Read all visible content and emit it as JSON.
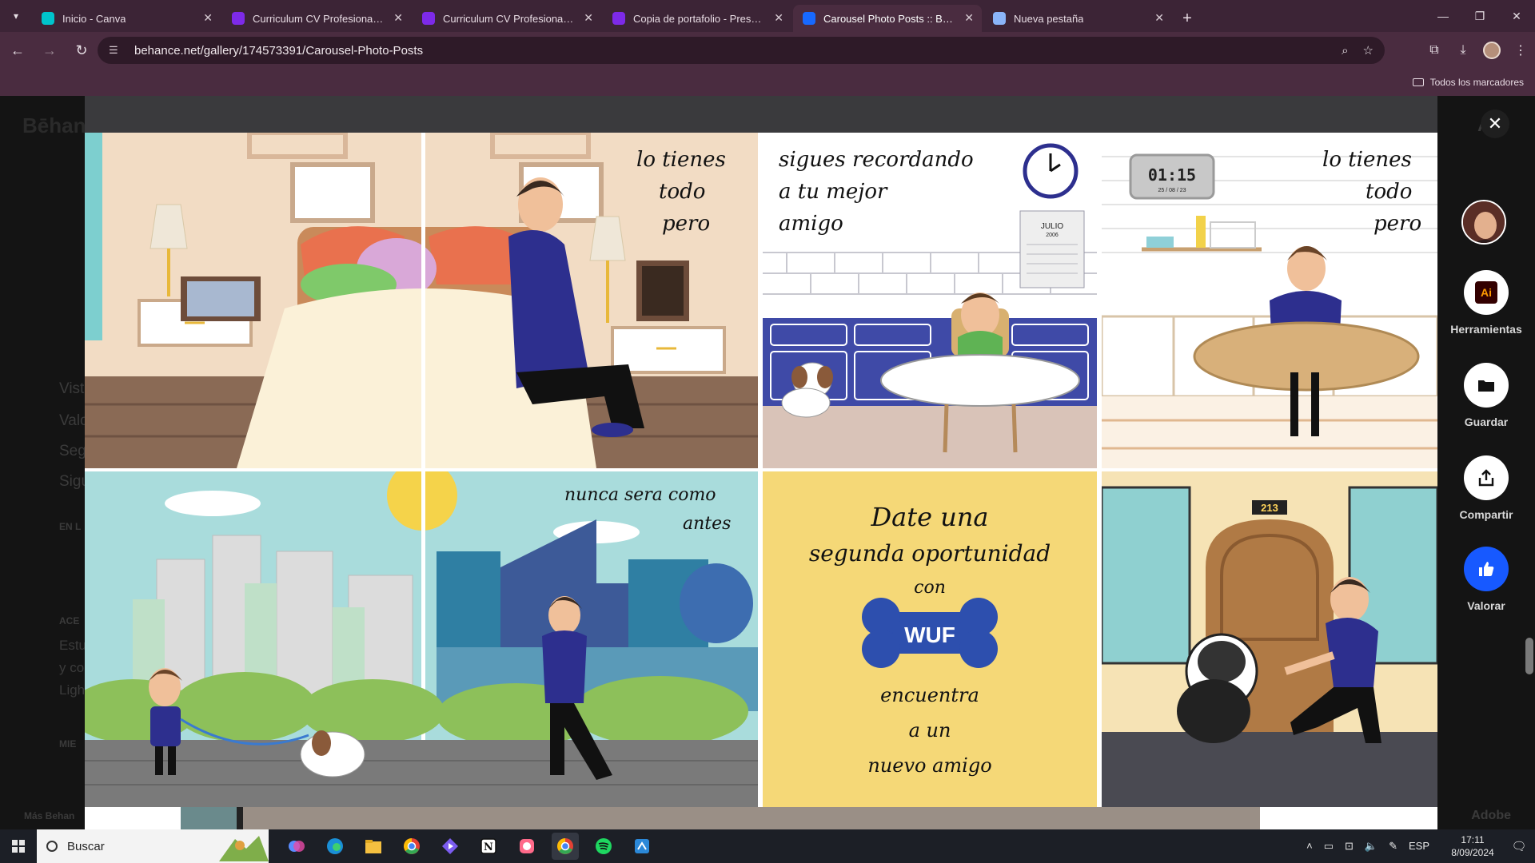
{
  "browser": {
    "tabs": [
      {
        "title": "Inicio - Canva",
        "favicon_color": "#00c4cc",
        "active": false
      },
      {
        "title": "Curriculum CV Profesional de M",
        "favicon_color": "#7d2ae8",
        "active": false
      },
      {
        "title": "Curriculum CV Profesional de M",
        "favicon_color": "#7d2ae8",
        "active": false
      },
      {
        "title": "Copia de portafolio - Presentac",
        "favicon_color": "#7d2ae8",
        "active": false
      },
      {
        "title": "Carousel Photo Posts :: Behance",
        "favicon_color": "#1769ff",
        "active": true
      },
      {
        "title": "Nueva pestaña",
        "favicon_color": "#8ab4f8",
        "active": false
      }
    ],
    "url": "behance.net/gallery/174573391/Carousel-Photo-Posts",
    "bookmarks_label": "Todos los marcadores"
  },
  "background_page": {
    "logo": "Bēhan",
    "lines": [
      "Vist",
      "Valo",
      "Segu",
      "Sigu"
    ],
    "section_labels": [
      "EN L",
      "ACE",
      "MIE"
    ],
    "body_lines": [
      "Estu",
      "y co",
      "Ligh"
    ],
    "footer": "Más Behan",
    "adobe": "Adobe"
  },
  "artwork": {
    "panel1_text": [
      "lo tienes",
      "todo",
      "pero"
    ],
    "panel2_text": [
      "sigues recordando",
      "a tu mejor",
      "amigo"
    ],
    "calendar_month": "JULIO",
    "calendar_year": "2006",
    "panel3_text": [
      "lo tienes",
      "todo",
      "pero"
    ],
    "digital_clock": "01:15",
    "digital_date": "25 / 08 / 23",
    "panel4_text": [
      "nunca sera como",
      "antes"
    ],
    "panel5_text": [
      "Date una",
      "segunda oportunidad",
      "con",
      "encuentra",
      "a un",
      "nuevo amigo"
    ],
    "brand": "WUF",
    "door_number": "213",
    "colors": {
      "sky": "#a9dcdc",
      "navy": "#2d2f8e",
      "kitchen_blue": "#3f4aa7",
      "yellow": "#f5d877",
      "wall_peach": "#f2dcc4"
    }
  },
  "rail": {
    "tools_label": "Herramientas",
    "save_label": "Guardar",
    "share_label": "Compartir",
    "appreciate_label": "Valorar",
    "accent": "#1759ff"
  },
  "taskbar": {
    "search_placeholder": "Buscar",
    "lang": "ESP",
    "time": "17:11",
    "date": "8/09/2024"
  }
}
